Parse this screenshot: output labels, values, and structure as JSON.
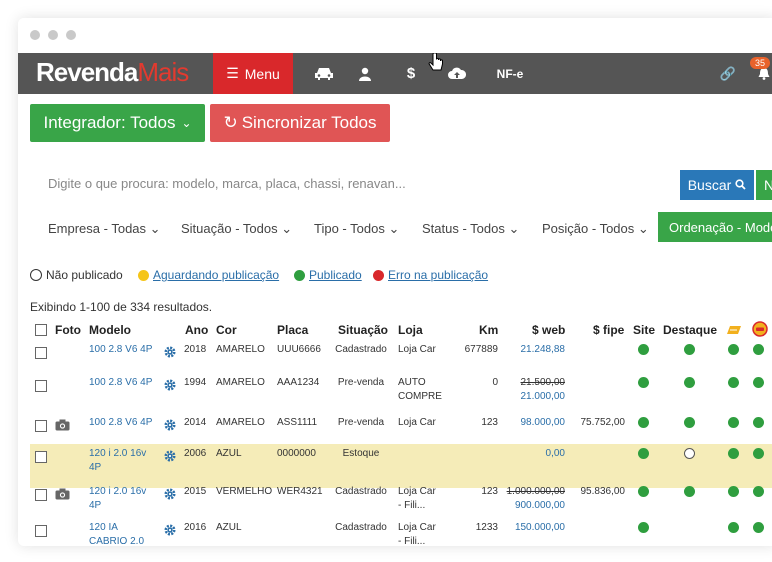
{
  "brand": {
    "name_a": "Revenda",
    "name_b": "Mais"
  },
  "nav": {
    "menu_label": "Menu",
    "nfe_label": "NF-e",
    "notification_count": "35",
    "icons": [
      "car-icon",
      "user-icon",
      "dollar-icon",
      "cloud-upload-icon",
      "link-icon",
      "bell-icon"
    ]
  },
  "actions": {
    "integrador_label": "Integrador: Todos",
    "sincronizar_label": "Sincronizar Todos"
  },
  "search": {
    "placeholder": "Digite o que procura: modelo, marca, placa, chassi, renavan...",
    "buscar_label": "Buscar",
    "novo_label": "N"
  },
  "filters": {
    "empresa": "Empresa - Todas",
    "situacao": "Situação - Todos",
    "tipo": "Tipo - Todos",
    "status": "Status - Todos",
    "posicao": "Posição - Todos",
    "ordenacao": "Ordenação - Mode"
  },
  "legend": {
    "nao_publicado": "Não publicado",
    "aguardando": "Aguardando publicação",
    "publicado": "Publicado",
    "erro": "Erro na publicação"
  },
  "results_text": "Exibindo 1-100 de 334 resultados.",
  "columns": {
    "foto": "Foto",
    "modelo": "Modelo",
    "ano": "Ano",
    "cor": "Cor",
    "placa": "Placa",
    "situacao": "Situação",
    "loja": "Loja",
    "km": "Km",
    "web": "$ web",
    "fipe": "$ fipe",
    "site": "Site",
    "destaque": "Destaque"
  },
  "colors": {
    "navbar": "#555555",
    "menu": "#d9282b",
    "green": "#39a548",
    "red": "#e05555",
    "blue": "#2a78b8",
    "highlight": "#f5ecb8"
  },
  "rows": [
    {
      "modelo_1": "100 2.8 V6 4P",
      "modelo_2": "",
      "ano": "2018",
      "cor": "AMARELO",
      "placa": "UUU6666",
      "situacao": "Cadastrado",
      "loja_1": "Loja Car",
      "loja_2": "",
      "km": "677889",
      "web_old": "",
      "web": "21.248,88",
      "fipe": "",
      "has_photo": false,
      "highlight": false,
      "destaque": "published"
    },
    {
      "modelo_1": "100 2.8 V6 4P",
      "modelo_2": "",
      "ano": "1994",
      "cor": "AMARELO",
      "placa": "AAA1234",
      "situacao": "Pre-venda",
      "loja_1": "AUTO",
      "loja_2": "COMPRE",
      "km": "0",
      "web_old": "21.500,00",
      "web": "21.000,00",
      "fipe": "",
      "has_photo": false,
      "highlight": false,
      "destaque": "published"
    },
    {
      "modelo_1": "100 2.8 V6 4P",
      "modelo_2": "",
      "ano": "2014",
      "cor": "AMARELO",
      "placa": "ASS1111",
      "situacao": "Pre-venda",
      "loja_1": "Loja Car",
      "loja_2": "",
      "km": "123",
      "web_old": "",
      "web": "98.000,00",
      "fipe": "75.752,00",
      "has_photo": true,
      "highlight": false,
      "destaque": "published"
    },
    {
      "modelo_1": "120 i 2.0 16v",
      "modelo_2": "4P",
      "ano": "2006",
      "cor": "AZUL",
      "placa": "0000000",
      "situacao": "Estoque",
      "loja_1": "",
      "loja_2": "",
      "km": "",
      "web_old": "",
      "web": "0,00",
      "fipe": "",
      "has_photo": false,
      "highlight": true,
      "destaque": "not_published"
    },
    {
      "modelo_1": "120 i 2.0 16v",
      "modelo_2": "4P",
      "ano": "2015",
      "cor": "VERMELHO",
      "placa": "WER4321",
      "situacao": "Cadastrado",
      "loja_1": "Loja Car",
      "loja_2": "- Fili...",
      "km": "123",
      "web_old": "1.000.000,00",
      "web": "900.000,00",
      "fipe": "95.836,00",
      "has_photo": true,
      "highlight": false,
      "destaque": "published"
    },
    {
      "modelo_1": "120 IA",
      "modelo_2": "CABRIO 2.0",
      "ano": "2016",
      "cor": "AZUL",
      "placa": "",
      "situacao": "Cadastrado",
      "loja_1": "Loja Car",
      "loja_2": "- Fili...",
      "km": "1233",
      "web_old": "",
      "web": "150.000,00",
      "fipe": "",
      "has_photo": false,
      "highlight": false,
      "destaque": "none"
    }
  ]
}
